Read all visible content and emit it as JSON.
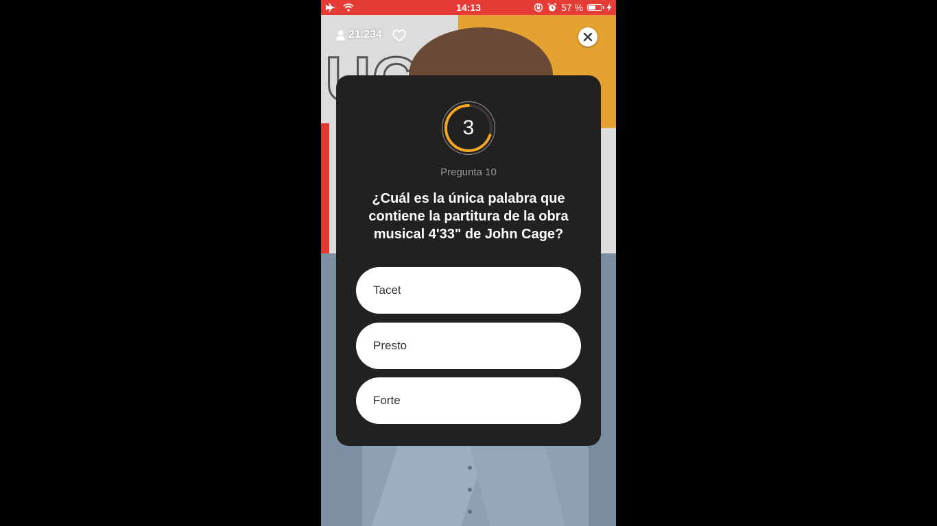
{
  "status_bar": {
    "time": "14:13",
    "battery_percent_label": "57 %",
    "battery_level": 0.57,
    "icons": [
      "airplane-icon",
      "wifi-icon",
      "rotation-lock-icon",
      "alarm-icon",
      "battery-icon",
      "charging-bolt-icon"
    ]
  },
  "header": {
    "viewer_count": "21.234"
  },
  "quiz": {
    "timer_value": "3",
    "timer_progress": 0.7,
    "accent_color": "#f5a623",
    "question_number": "Pregunta 10",
    "question_text": "¿Cuál es la única palabra que contiene la partitura de la obra musical 4'33\" de John Cage?",
    "answers": [
      {
        "label": "Tacet"
      },
      {
        "label": "Presto"
      },
      {
        "label": "Forte"
      }
    ]
  },
  "colors": {
    "status_bar": "#e53d35",
    "card_background": "#232020"
  }
}
